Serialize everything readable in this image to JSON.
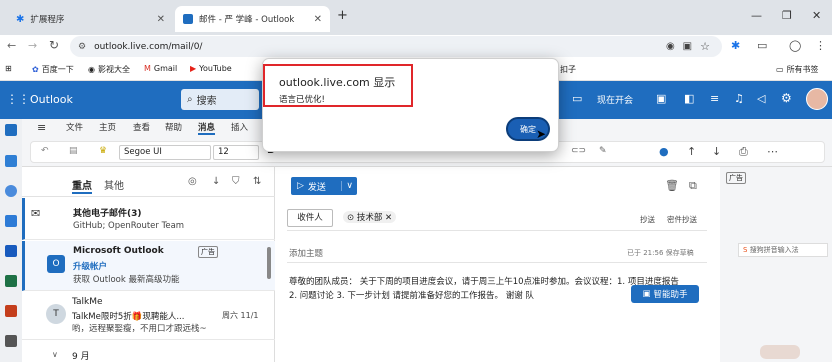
{
  "browser": {
    "tabs": [
      {
        "label": "扩展程序",
        "active": false
      },
      {
        "label": "邮件 - 严 学峰 - Outlook",
        "active": true
      }
    ],
    "url": "outlook.live.com/mail/0/",
    "bookmarks": [
      "百度一下",
      "影视大全",
      "Gmail",
      "YouTube",
      "扣子",
      "所有书签"
    ]
  },
  "outlook": {
    "app_name": "Outlook",
    "search_placeholder": "搜索",
    "meeting_label": "现在开会",
    "ribbon_tabs": [
      "文件",
      "主页",
      "查看",
      "帮助",
      "消息",
      "插入"
    ],
    "active_ribbon_tab": "消息",
    "font_name": "Segoe UI",
    "font_size": "12",
    "list_tabs": {
      "focused": "重点",
      "other": "其他"
    },
    "messages": [
      {
        "sender": "其他电子邮件(3)",
        "preview": "GitHub; OpenRouter Team",
        "time": "",
        "badge": ""
      },
      {
        "sender": "Microsoft Outlook",
        "subject": "升级帐户",
        "preview": "获取 Outlook 最新高级功能",
        "badge": "广告",
        "time": ""
      },
      {
        "sender": "TalkMe",
        "subject": "TalkMe限时5折🎁现聘能人...",
        "preview": "哟，远程聚娶瘦，不用口才跟远栈~",
        "time": "周六 11/1",
        "avatar": "T"
      }
    ],
    "month_group": "9 月",
    "compose": {
      "send_label": "发送",
      "to_label": "收件人",
      "recipient": "技术部",
      "cc_label": "抄送",
      "bcc_label": "密件抄送",
      "subject_placeholder": "添加主题",
      "draft_status": "已于 21:56 保存草稿",
      "body": "尊敬的团队成员： 关于下周的项目进度会议，请于周三上午10点准时参加。会议议程：1. 项目进度报告 2. 问题讨论 3. 下一步计划 请提前准备好您的工作报告。 谢谢 队",
      "assistant_label": "智能助手"
    },
    "ad_badge": "广告",
    "ime_label": "搜狗拼音输入法"
  },
  "dialog": {
    "title": "outlook.live.com 显示",
    "message": "语言已优化!",
    "ok_label": "确定"
  },
  "colors": {
    "outlook_blue": "#1f6dbf",
    "highlight_red": "#e0262a",
    "ok_button": "#1a5fb4"
  }
}
